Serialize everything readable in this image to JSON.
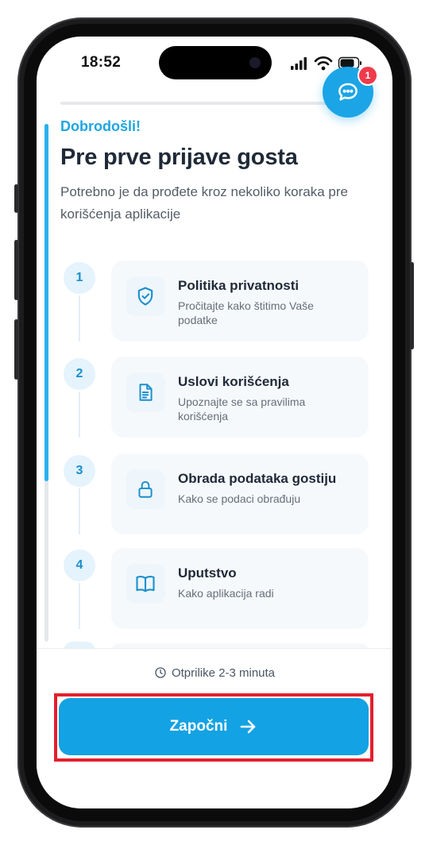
{
  "status_bar": {
    "time": "18:52"
  },
  "intro": {
    "welcome": "Dobrodošli!",
    "title": "Pre prve prijave gosta",
    "subtitle": "Potrebno je da prođete kroz nekoliko koraka pre korišćenja aplikacije"
  },
  "progress": {
    "value": 0.0
  },
  "steps": [
    {
      "number": "1",
      "title": "Politika privatnosti",
      "description": "Pročitajte kako štitimo Vaše podatke",
      "icon": "shield-check-icon"
    },
    {
      "number": "2",
      "title": "Uslovi korišćenja",
      "description": "Upoznajte se sa pravilima korišćenja",
      "icon": "document-icon"
    },
    {
      "number": "3",
      "title": "Obrada podataka gostiju",
      "description": "Kako se podaci obrađuju",
      "icon": "lock-icon"
    },
    {
      "number": "4",
      "title": "Uputstvo",
      "description": "Kako aplikacija radi",
      "icon": "book-icon"
    }
  ],
  "footer": {
    "time_estimate": "Otprilike 2-3 minuta",
    "start_label": "Započni"
  },
  "chat": {
    "badge_count": "1"
  },
  "colors": {
    "accent": "#13a2e3",
    "badge": "#ef3b4b",
    "highlight": "#e3202e"
  }
}
